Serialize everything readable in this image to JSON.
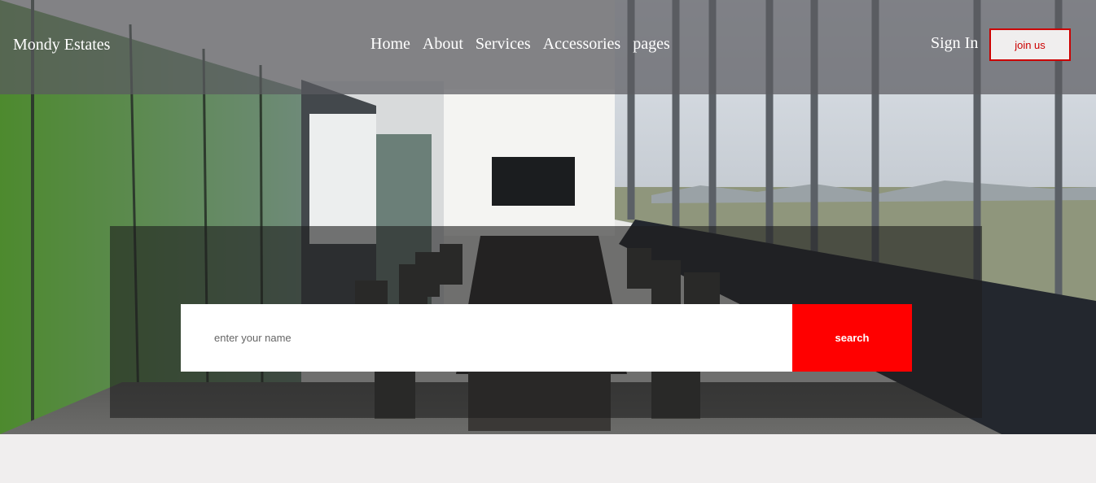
{
  "brand": {
    "name": "Mondy Estates"
  },
  "nav": {
    "items": [
      {
        "label": "Home"
      },
      {
        "label": "About"
      },
      {
        "label": "Services"
      },
      {
        "label": "Accessories"
      },
      {
        "label": "pages"
      }
    ]
  },
  "account": {
    "sign_in_label": "Sign In",
    "join_label": "join us"
  },
  "search": {
    "placeholder": "enter your name",
    "value": "",
    "button_label": "search"
  },
  "colors": {
    "accent": "#ff0000",
    "join_border": "#cc0000",
    "page_bg": "#f0eeee"
  }
}
